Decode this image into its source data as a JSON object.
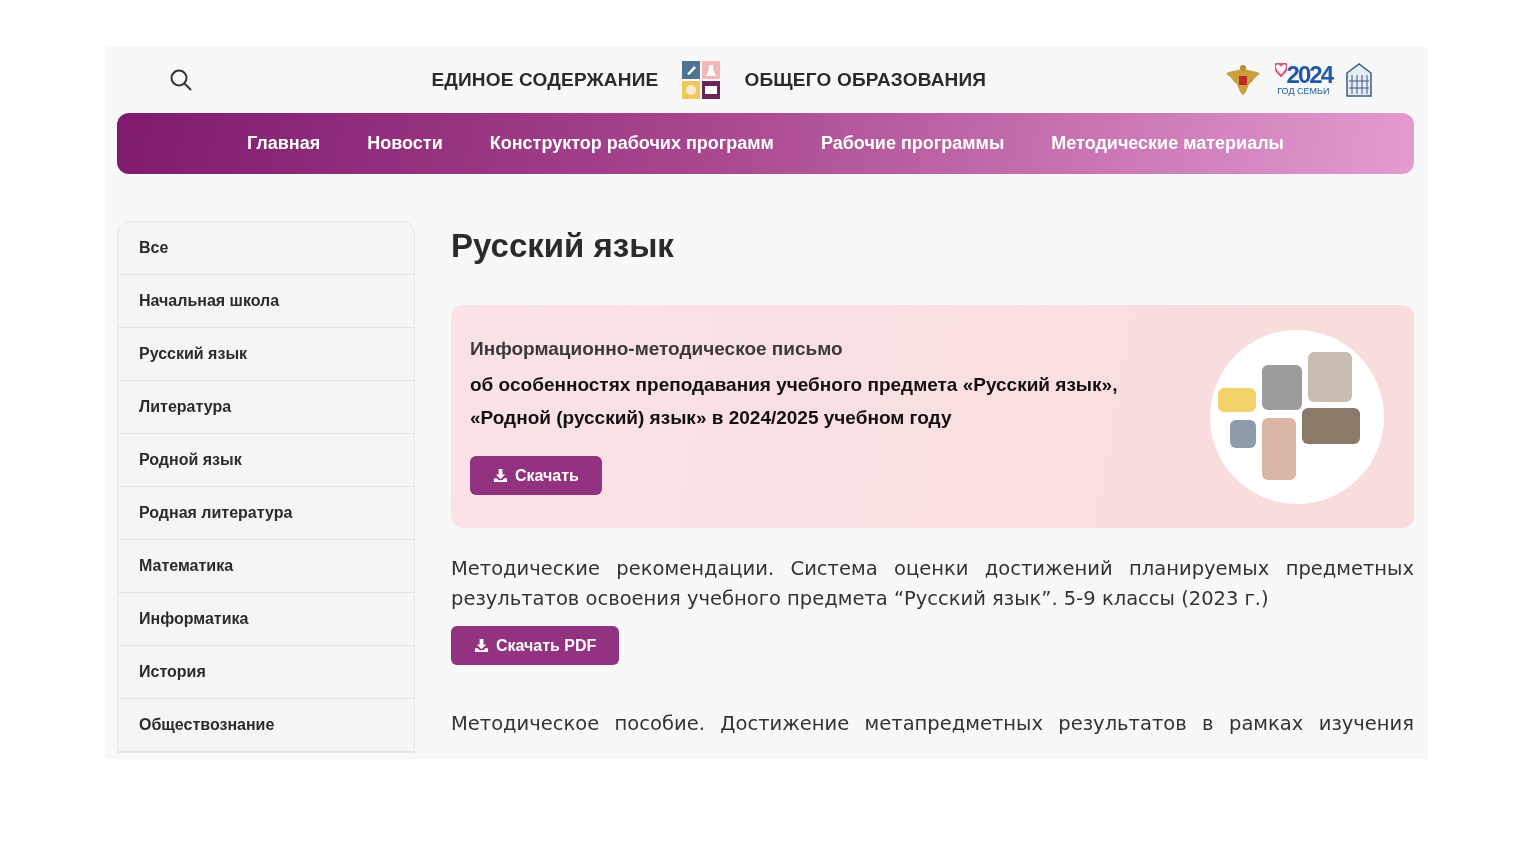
{
  "header": {
    "title_left": "ЕДИНОЕ СОДЕРЖАНИЕ",
    "title_right": "ОБЩЕГО ОБРАЗОВАНИЯ",
    "year_logo": {
      "year": "2024",
      "caption": "ГОД СЕМЬИ"
    }
  },
  "nav": [
    {
      "label": "Главная"
    },
    {
      "label": "Новости"
    },
    {
      "label": "Конструктор рабочих программ"
    },
    {
      "label": "Рабочие программы"
    },
    {
      "label": "Методические материалы"
    }
  ],
  "sidebar": {
    "items": [
      {
        "label": "Все"
      },
      {
        "label": "Начальная школа"
      },
      {
        "label": "Русский язык"
      },
      {
        "label": "Литература"
      },
      {
        "label": "Родной язык"
      },
      {
        "label": "Родная литература"
      },
      {
        "label": "Математика"
      },
      {
        "label": "Информатика"
      },
      {
        "label": "История"
      },
      {
        "label": "Обществознание"
      }
    ]
  },
  "page_title": "Русский язык",
  "featured": {
    "heading": "Информационно-методическое письмо",
    "lines": [
      "об особенностях преподавания учебного предмета «Русский язык»,",
      "«Родной (русский) язык» в 2024/2025 учебном году"
    ],
    "button": "Скачать"
  },
  "documents": [
    {
      "text": "Методические рекомендации. Система оценки достижений планируемых предметных результатов освоения учебного предмета “Русский язык”. 5-9 классы (2023 г.)",
      "button": "Скачать PDF"
    },
    {
      "text": "Методическое пособие. Достижение метапредметных результатов в рамках изучения"
    }
  ]
}
